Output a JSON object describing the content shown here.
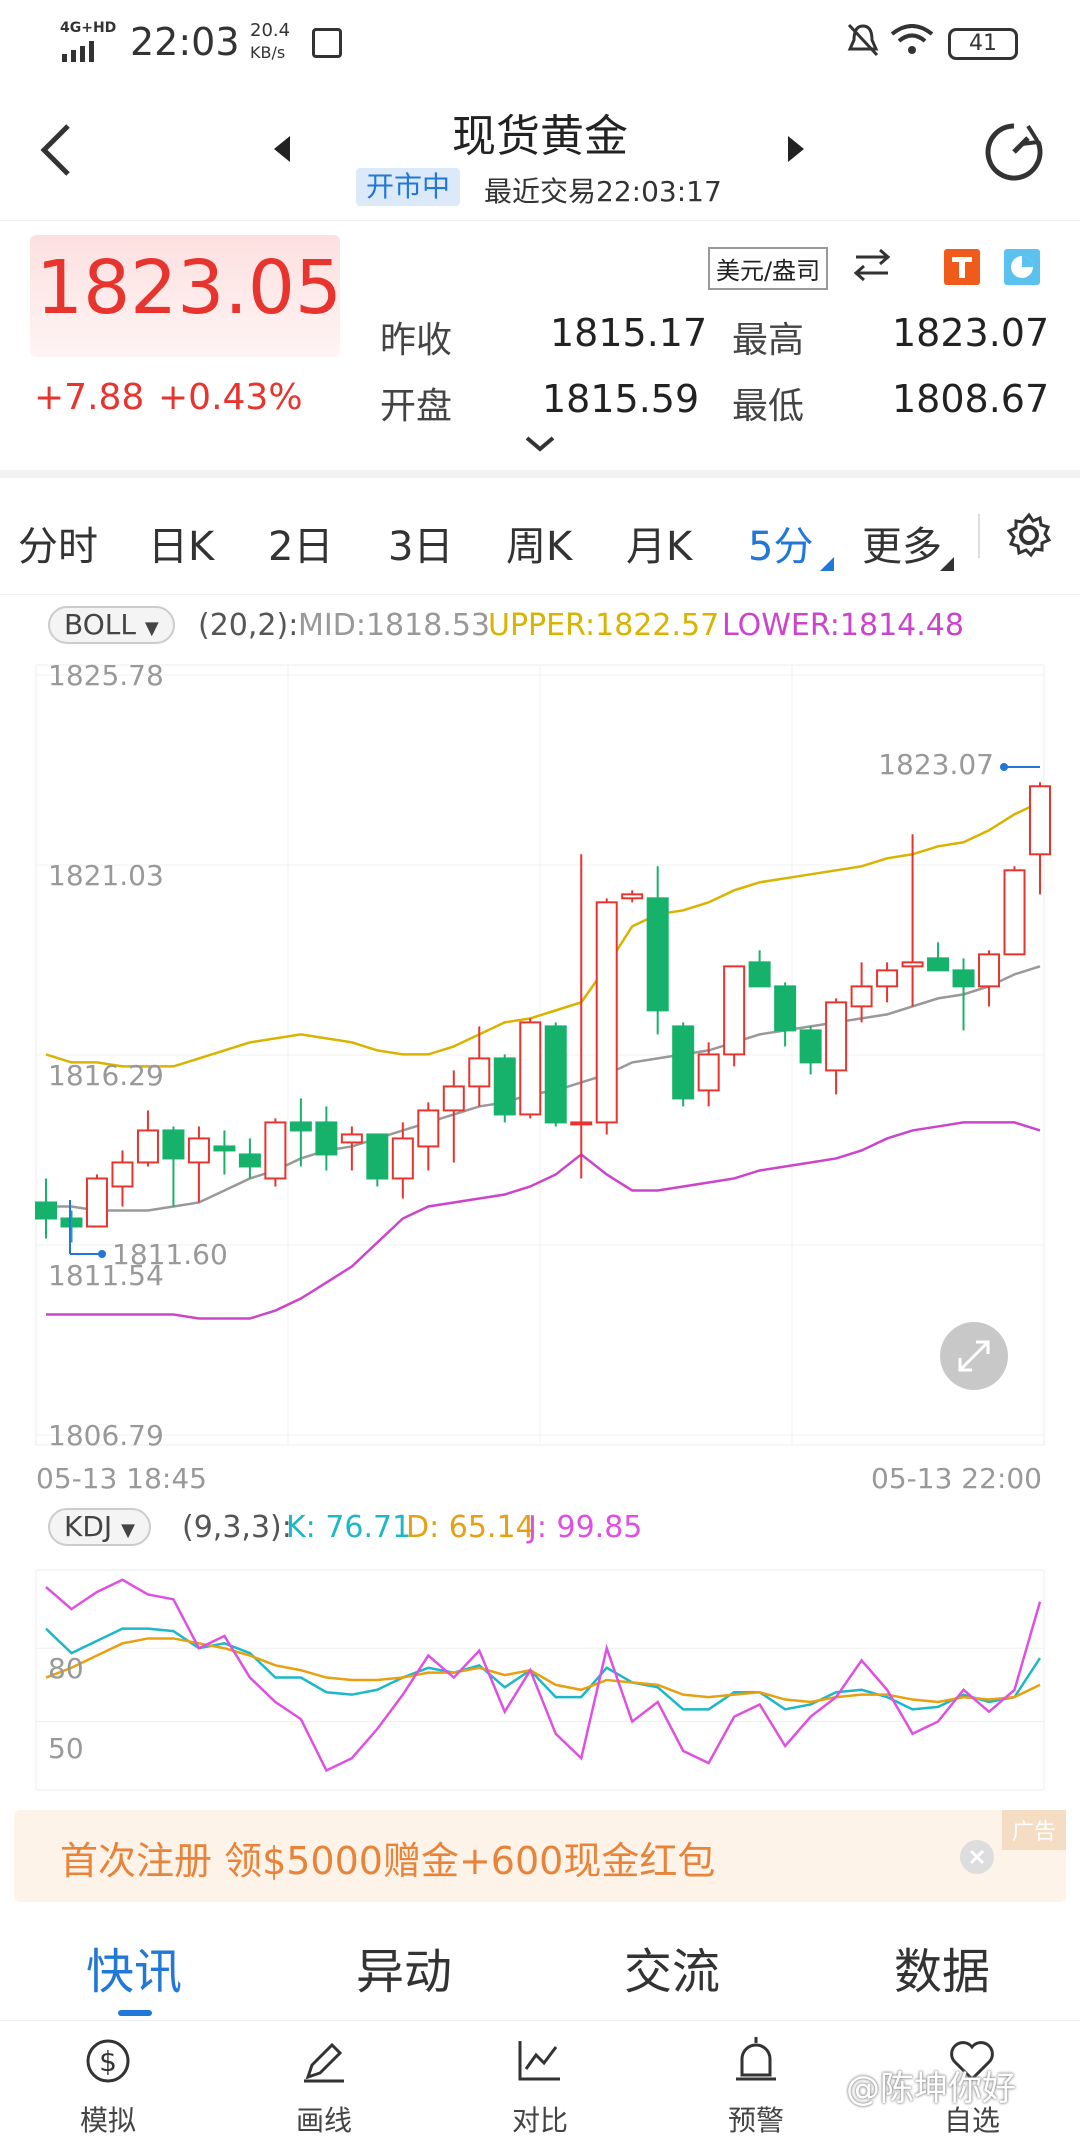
{
  "status_bar": {
    "network": "4G+HD",
    "time": "22:03",
    "speed_value": "20.4",
    "speed_unit": "KB/s",
    "battery": "41"
  },
  "nav": {
    "title": "现货黄金",
    "market_status": "开市中",
    "last_trade": "最近交易22:03:17"
  },
  "quote": {
    "price": "1823.05",
    "change": "+7.88",
    "change_pct": "+0.43%",
    "unit": "美元/盎司",
    "prev_close_label": "昨收",
    "prev_close": "1815.17",
    "high_label": "最高",
    "high": "1823.07",
    "open_label": "开盘",
    "open": "1815.59",
    "low_label": "最低",
    "low": "1808.67",
    "up_color": "#e8342e",
    "down_color": "#16b26b"
  },
  "period_tabs": [
    "分时",
    "日K",
    "2日",
    "3日",
    "周K",
    "月K",
    "5分",
    "更多"
  ],
  "active_period": "5分",
  "boll": {
    "chip": "BOLL",
    "params": "(20,2):",
    "mid": "MID:1818.53",
    "upper": "UPPER:1822.57",
    "lower": "LOWER:1814.48",
    "mid_color": "#999999",
    "upper_color": "#d9b300",
    "lower_color": "#cc44cc"
  },
  "kdj": {
    "chip": "KDJ",
    "params": "(9,3,3):",
    "k": "K: 76.71",
    "d": "D: 65.14",
    "j": "J: 99.85",
    "k_color": "#1cb8c8",
    "d_color": "#e8a010",
    "j_color": "#e050e0"
  },
  "chart_data": [
    {
      "type": "candlestick",
      "y_ticks": [
        "1825.78",
        "1821.03",
        "1816.29",
        "1811.54",
        "1806.79"
      ],
      "ylim": [
        1806.79,
        1825.78
      ],
      "x_start": "05-13 18:45",
      "x_end": "05-13 22:00",
      "max_label": "1823.07",
      "min_label": "1811.60",
      "candles": [
        [
          1812.6,
          1812.2,
          1813.2,
          1811.7
        ],
        [
          1812.2,
          1812.0,
          1812.4,
          1811.6
        ],
        [
          1812.0,
          1813.2,
          1813.3,
          1812.0
        ],
        [
          1813.0,
          1813.6,
          1813.9,
          1812.5
        ],
        [
          1813.6,
          1814.4,
          1814.9,
          1813.5
        ],
        [
          1814.4,
          1813.7,
          1814.5,
          1812.5
        ],
        [
          1813.6,
          1814.2,
          1814.5,
          1812.6
        ],
        [
          1814.0,
          1813.9,
          1814.4,
          1813.3
        ],
        [
          1813.8,
          1813.5,
          1814.2,
          1813.2
        ],
        [
          1813.2,
          1814.6,
          1814.7,
          1813.0
        ],
        [
          1814.6,
          1814.4,
          1815.2,
          1813.5
        ],
        [
          1814.6,
          1813.8,
          1815.0,
          1813.4
        ],
        [
          1814.1,
          1814.3,
          1814.5,
          1813.4
        ],
        [
          1814.3,
          1813.2,
          1814.3,
          1813.0
        ],
        [
          1813.2,
          1814.2,
          1814.6,
          1812.7
        ],
        [
          1814.0,
          1814.9,
          1815.1,
          1813.4
        ],
        [
          1814.9,
          1815.5,
          1815.9,
          1813.6
        ],
        [
          1815.5,
          1816.2,
          1817.0,
          1815.0
        ],
        [
          1816.2,
          1814.8,
          1816.3,
          1814.6
        ],
        [
          1814.8,
          1817.1,
          1817.2,
          1814.7
        ],
        [
          1817.0,
          1814.6,
          1817.1,
          1814.5
        ],
        [
          1814.6,
          1814.6,
          1821.3,
          1813.2
        ],
        [
          1814.6,
          1820.1,
          1820.2,
          1814.3
        ],
        [
          1820.2,
          1820.3,
          1820.4,
          1820.1
        ],
        [
          1820.2,
          1817.4,
          1821.0,
          1816.8
        ],
        [
          1817.0,
          1815.2,
          1817.1,
          1815.0
        ],
        [
          1815.4,
          1816.3,
          1816.6,
          1815.0
        ],
        [
          1816.3,
          1818.5,
          1818.5,
          1816.0
        ],
        [
          1818.6,
          1818.0,
          1818.9,
          1818.1
        ],
        [
          1818.0,
          1816.9,
          1818.1,
          1816.5
        ],
        [
          1816.9,
          1816.1,
          1817.0,
          1815.8
        ],
        [
          1815.9,
          1817.6,
          1817.7,
          1815.3
        ],
        [
          1817.5,
          1818.0,
          1818.6,
          1817.1
        ],
        [
          1818.0,
          1818.4,
          1818.6,
          1817.6
        ],
        [
          1818.5,
          1818.6,
          1821.8,
          1817.5
        ],
        [
          1818.7,
          1818.4,
          1819.1,
          1818.4
        ],
        [
          1818.4,
          1818.0,
          1818.7,
          1816.9
        ],
        [
          1818.0,
          1818.8,
          1818.9,
          1817.5
        ],
        [
          1818.8,
          1820.9,
          1821.0,
          1818.8
        ],
        [
          1821.3,
          1823.0,
          1823.1,
          1820.3
        ]
      ],
      "boll_upper": [
        1816.3,
        1816.1,
        1816.1,
        1816.0,
        1816.0,
        1816.0,
        1816.2,
        1816.4,
        1816.6,
        1816.7,
        1816.8,
        1816.7,
        1816.6,
        1816.4,
        1816.3,
        1816.3,
        1816.5,
        1816.8,
        1817.1,
        1817.2,
        1817.4,
        1817.6,
        1818.5,
        1819.5,
        1819.8,
        1819.9,
        1820.1,
        1820.4,
        1820.6,
        1820.7,
        1820.8,
        1820.9,
        1821.0,
        1821.2,
        1821.3,
        1821.5,
        1821.6,
        1821.9,
        1822.3,
        1822.6
      ],
      "boll_mid": [
        1812.5,
        1812.5,
        1812.4,
        1812.4,
        1812.4,
        1812.5,
        1812.6,
        1812.9,
        1813.2,
        1813.4,
        1813.7,
        1813.9,
        1814.0,
        1814.2,
        1814.4,
        1814.6,
        1814.8,
        1815.0,
        1815.1,
        1815.3,
        1815.4,
        1815.6,
        1815.8,
        1816.1,
        1816.2,
        1816.3,
        1816.4,
        1816.6,
        1816.8,
        1816.9,
        1817.0,
        1817.1,
        1817.2,
        1817.3,
        1817.5,
        1817.7,
        1817.8,
        1818.0,
        1818.3,
        1818.5
      ],
      "boll_lower": [
        1809.8,
        1809.8,
        1809.8,
        1809.8,
        1809.8,
        1809.8,
        1809.7,
        1809.7,
        1809.7,
        1809.9,
        1810.2,
        1810.6,
        1811.0,
        1811.6,
        1812.2,
        1812.5,
        1812.6,
        1812.7,
        1812.8,
        1813.0,
        1813.3,
        1813.8,
        1813.3,
        1812.9,
        1812.9,
        1813.0,
        1813.1,
        1813.2,
        1813.4,
        1813.5,
        1813.6,
        1813.7,
        1813.9,
        1814.2,
        1814.4,
        1814.5,
        1814.6,
        1814.6,
        1814.6,
        1814.4
      ]
    },
    {
      "type": "line",
      "y_ticks": [
        "80",
        "50"
      ],
      "ylim": [
        22,
        112
      ],
      "series": [
        {
          "name": "K",
          "values": [
            88,
            78,
            83,
            88,
            88,
            87,
            80,
            82,
            78,
            68,
            68,
            62,
            61,
            63,
            68,
            72,
            70,
            73,
            64,
            71,
            60,
            60,
            72,
            66,
            64,
            55,
            55,
            62,
            62,
            55,
            57,
            62,
            63,
            60,
            55,
            56,
            61,
            58,
            60,
            76
          ]
        },
        {
          "name": "D",
          "values": [
            68,
            72,
            77,
            82,
            84,
            84,
            82,
            80,
            77,
            73,
            71,
            68,
            67,
            67,
            68,
            70,
            70,
            72,
            69,
            71,
            65,
            63,
            67,
            66,
            65,
            61,
            60,
            61,
            62,
            59,
            58,
            60,
            61,
            61,
            59,
            58,
            60,
            59,
            60,
            65
          ]
        },
        {
          "name": "J",
          "values": [
            105,
            96,
            103,
            108,
            102,
            100,
            80,
            85,
            68,
            58,
            51,
            30,
            35,
            47,
            61,
            77,
            68,
            79,
            54,
            71,
            45,
            35,
            80,
            50,
            58,
            38,
            33,
            52,
            57,
            40,
            52,
            60,
            75,
            63,
            45,
            50,
            63,
            54,
            63,
            99
          ]
        }
      ]
    }
  ],
  "ad": {
    "text": "首次注册 领$5000赠金+600现金红包",
    "tag": "广告"
  },
  "news_tabs": [
    "快讯",
    "异动",
    "交流",
    "数据"
  ],
  "bottom_nav": [
    "模拟",
    "画线",
    "对比",
    "预警",
    "自选"
  ],
  "watermark": "@陈坤你好"
}
